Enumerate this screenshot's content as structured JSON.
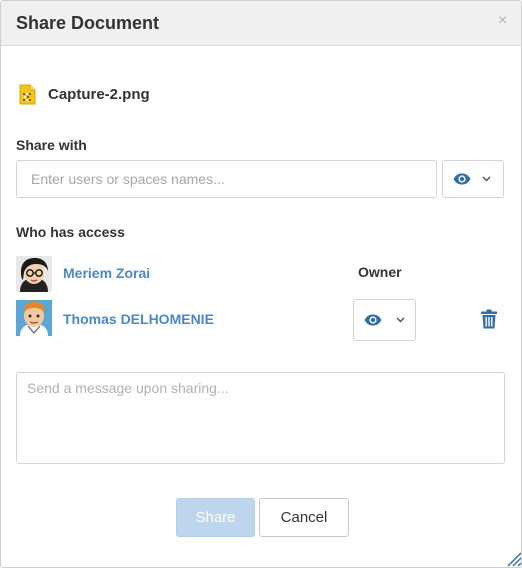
{
  "dialog": {
    "title": "Share Document",
    "close_symbol": "×"
  },
  "file": {
    "icon": "image-file-icon",
    "name": "Capture-2.png"
  },
  "share_with": {
    "label": "Share with",
    "placeholder": "Enter users or spaces names...",
    "value": "",
    "permission_icon": "eye-icon"
  },
  "access": {
    "label": "Who has access",
    "users": [
      {
        "name": "Meriem Zorai",
        "role": "Owner",
        "avatar": "avatar-icon"
      },
      {
        "name": "Thomas DELHOMENIE",
        "permission_icon": "eye-icon",
        "remove_icon": "trash-icon",
        "avatar": "avatar-icon"
      }
    ]
  },
  "message": {
    "placeholder": "Send a message upon sharing...",
    "value": ""
  },
  "buttons": {
    "share_label": "Share",
    "cancel_label": "Cancel"
  },
  "colors": {
    "link": "#4a88c7",
    "icon_blue": "#2d6fa6",
    "share_button_disabled": "#bdd6ee",
    "header_bg": "#f0f0f0"
  }
}
